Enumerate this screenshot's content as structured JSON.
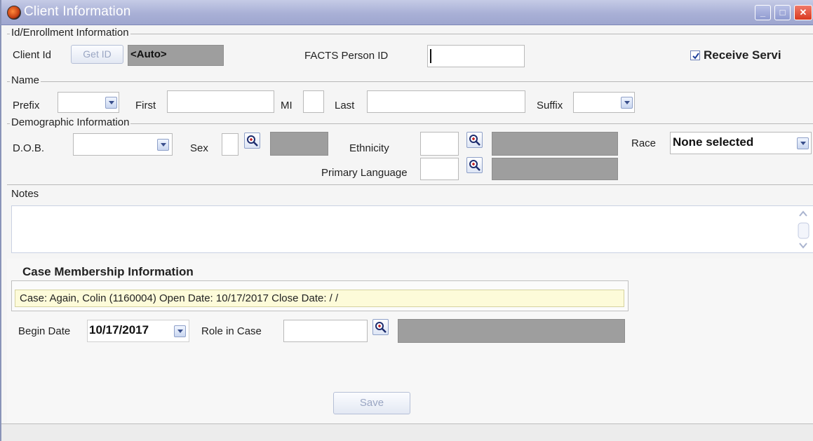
{
  "window": {
    "title": "Client Information",
    "controls": {
      "minimize": "_",
      "maximize": "□",
      "close": "✕"
    }
  },
  "id_section": {
    "legend": "Id/Enrollment Information",
    "client_id_label": "Client Id",
    "get_id_button": "Get ID",
    "client_id_value": "<Auto>",
    "facts_person_id_label": "FACTS Person ID",
    "facts_person_id_value": "",
    "receive_services_label": "Receive Servi",
    "receive_services_checked": true
  },
  "name_section": {
    "legend": "Name",
    "prefix_label": "Prefix",
    "prefix_value": "",
    "first_label": "First",
    "first_value": "",
    "mi_label": "MI",
    "mi_value": "",
    "last_label": "Last",
    "last_value": "",
    "suffix_label": "Suffix",
    "suffix_value": ""
  },
  "demographic_section": {
    "legend": "Demographic Information",
    "dob_label": "D.O.B.",
    "dob_value": "",
    "sex_label": "Sex",
    "sex_value": "",
    "ethnicity_label": "Ethnicity",
    "ethnicity_value": "",
    "race_label": "Race",
    "race_value": "None selected",
    "primary_language_label": "Primary Language",
    "primary_language_value": ""
  },
  "notes_section": {
    "legend": "Notes",
    "value": ""
  },
  "case_section": {
    "heading": "Case Membership Information",
    "case_line": "Case: Again, Colin (1160004) Open Date: 10/17/2017 Close Date:  / /",
    "begin_date_label": "Begin Date",
    "begin_date_value": "10/17/2017",
    "role_label": "Role in Case",
    "role_value": ""
  },
  "footer": {
    "save_button": "Save"
  },
  "colors": {
    "title_bar": "#a9b0d6",
    "close_button": "#d9391f",
    "readonly_gray": "#9e9e9e",
    "case_highlight": "#fdfbd9"
  }
}
